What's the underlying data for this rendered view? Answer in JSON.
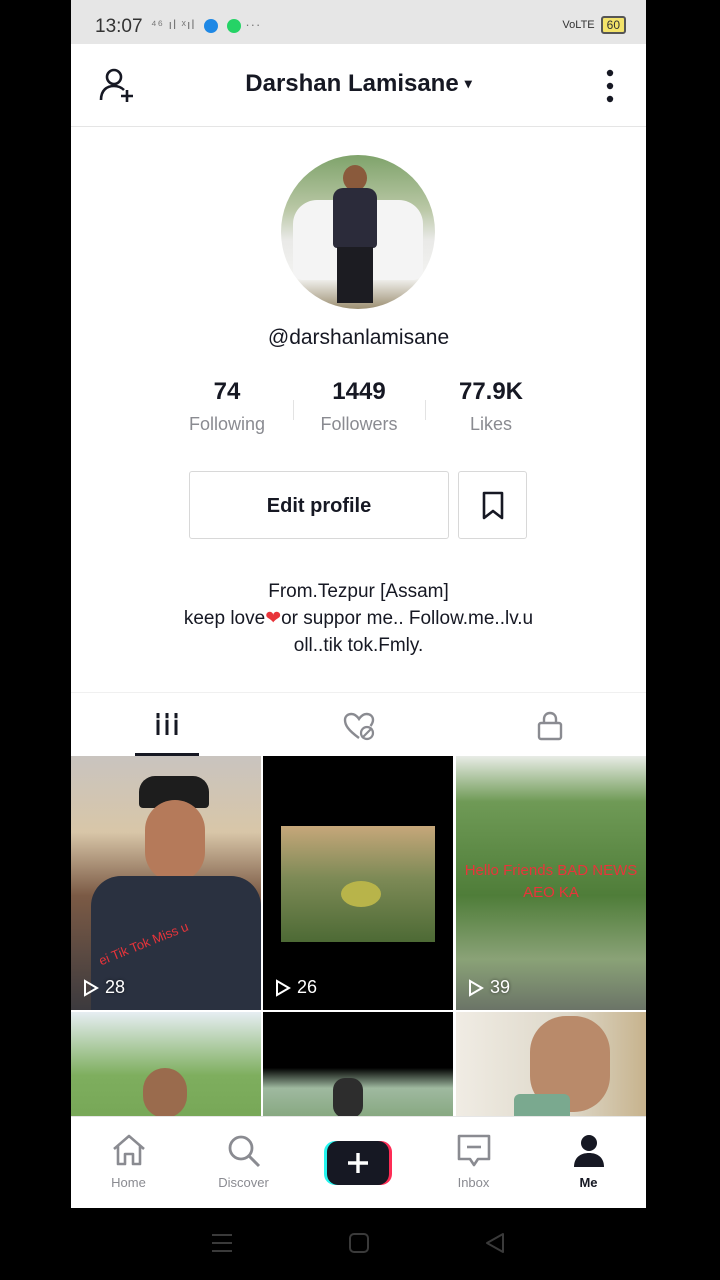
{
  "status_bar": {
    "time": "13:07",
    "signal_icons": "⁴⁶ ıl ˣıl",
    "more": "···",
    "network": "VoLTE",
    "battery": "60"
  },
  "header": {
    "title": "Darshan Lamisane",
    "caret": "▾"
  },
  "profile": {
    "handle": "@darshanlamisane",
    "stats": [
      {
        "value": "74",
        "label": "Following"
      },
      {
        "value": "1449",
        "label": "Followers"
      },
      {
        "value": "77.9K",
        "label": "Likes"
      }
    ],
    "edit_button": "Edit profile",
    "bio": {
      "line1": "From.Tezpur [Assam]",
      "line2_pre": "keep love",
      "line2_heart": "❤",
      "line2_post": "or suppor me.. Follow.me..lv.u",
      "line3": "oll..tik tok.Fmly."
    }
  },
  "videos": [
    {
      "views": "28",
      "caption": "ei Tik Tok Miss u"
    },
    {
      "views": "26",
      "caption": ""
    },
    {
      "views": "39",
      "caption": "Hello Friends BAD NEWS AEO KA"
    },
    {
      "views": "",
      "caption": ""
    },
    {
      "views": "",
      "caption": ""
    },
    {
      "views": "",
      "caption": ""
    }
  ],
  "bottom_nav": [
    {
      "label": "Home",
      "icon": "home-icon"
    },
    {
      "label": "Discover",
      "icon": "search-icon"
    },
    {
      "label": "",
      "icon": "plus-icon"
    },
    {
      "label": "Inbox",
      "icon": "inbox-icon"
    },
    {
      "label": "Me",
      "icon": "profile-icon"
    }
  ],
  "colors": {
    "accent_red": "#e8343a",
    "cyan": "#25f4ee",
    "pink": "#fe2c55",
    "text_primary": "#161823",
    "text_secondary": "#8a8b91"
  }
}
